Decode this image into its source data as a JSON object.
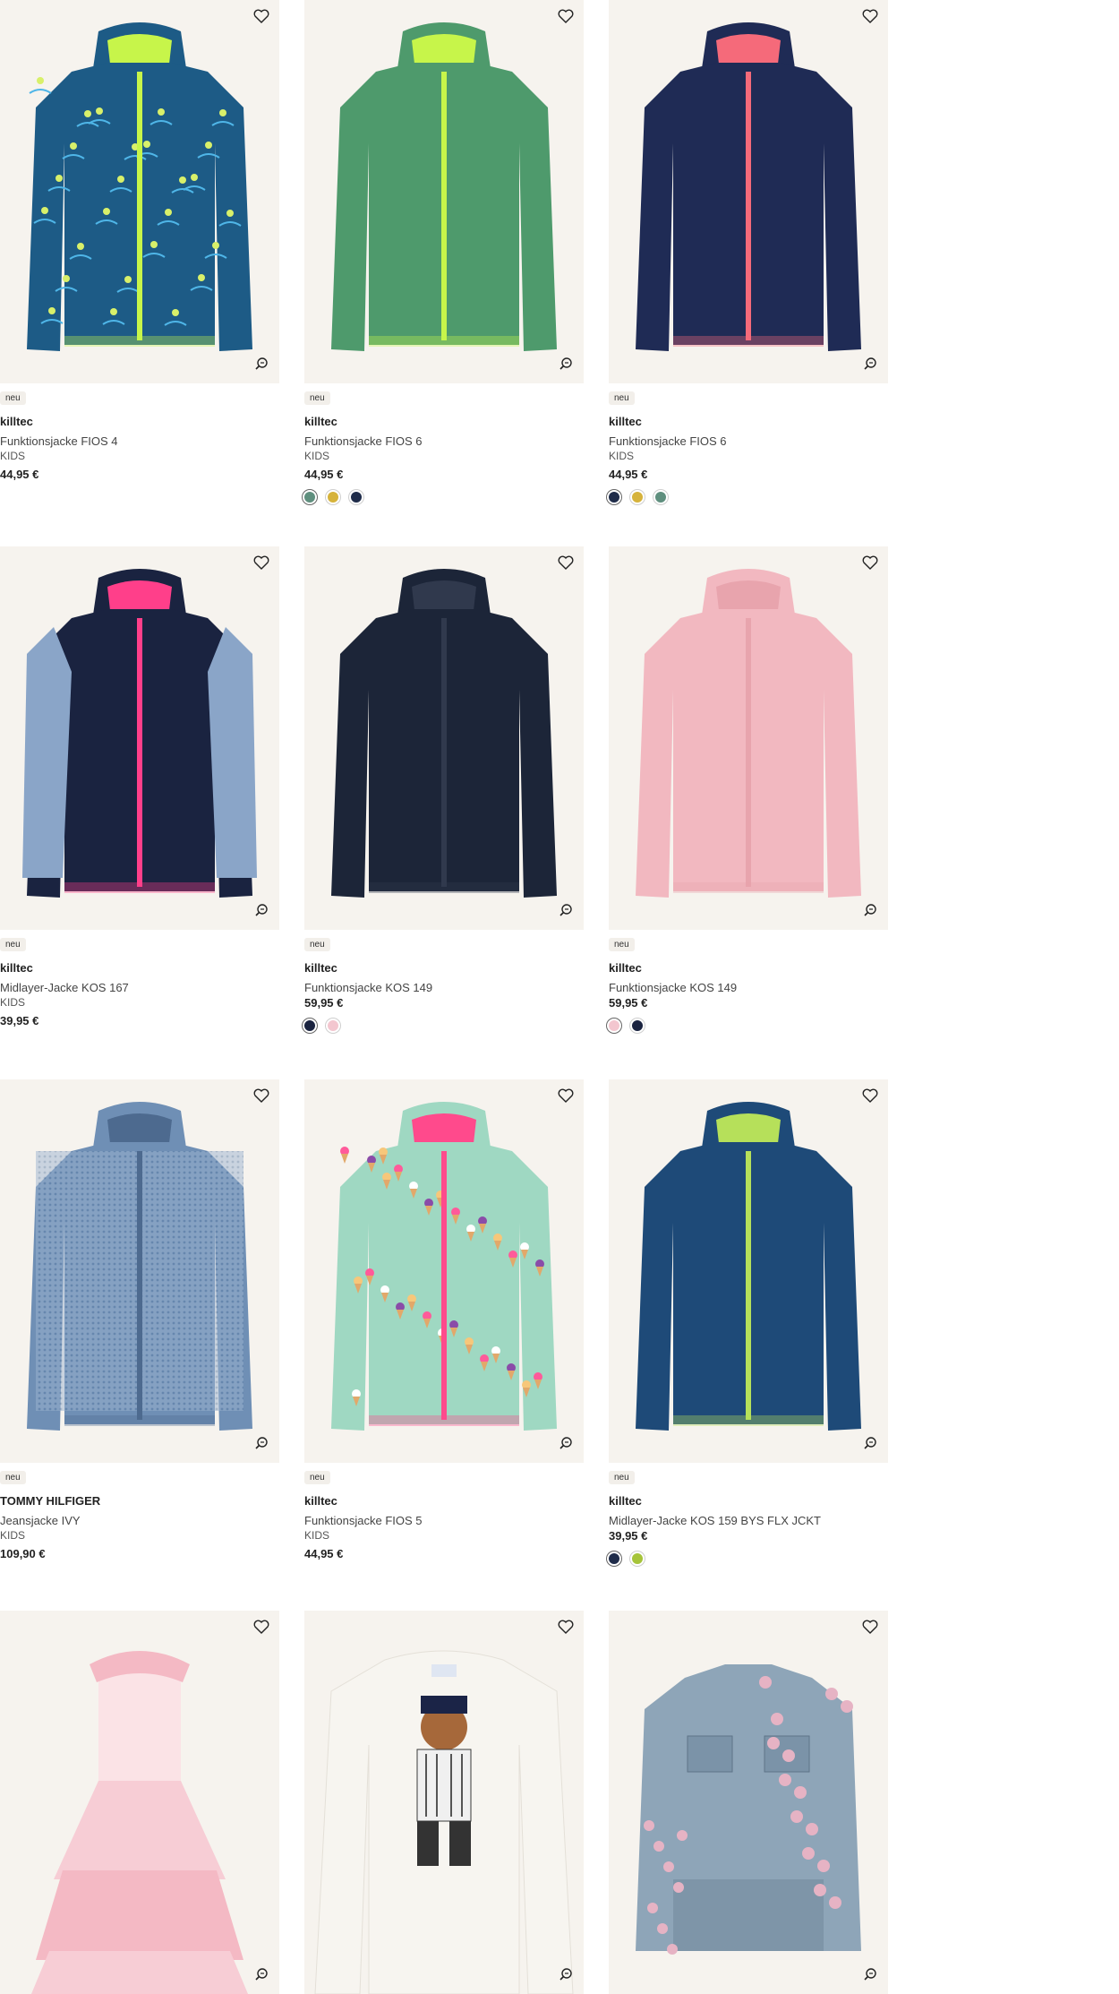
{
  "products": [
    {
      "badge": "neu",
      "brand": "killtec",
      "name": "Funktionsjacke FIOS 4",
      "sub": "KIDS",
      "price": "44,95 €",
      "colors": [],
      "art": {
        "body": "#1d5b86",
        "accent": "#c7f54a",
        "pattern": "palm"
      }
    },
    {
      "badge": "neu",
      "brand": "killtec",
      "name": "Funktionsjacke FIOS 6",
      "sub": "KIDS",
      "price": "44,95 €",
      "colors": [
        "#5f8f7e",
        "#d6b33b",
        "#1f2c4a"
      ],
      "art": {
        "body": "#4e9a6c",
        "accent": "#c7f54a",
        "pattern": "plain"
      }
    },
    {
      "badge": "neu",
      "brand": "killtec",
      "name": "Funktionsjacke FIOS 6",
      "sub": "KIDS",
      "price": "44,95 €",
      "colors": [
        "#1f2c4a",
        "#d6b33b",
        "#5f8f7e"
      ],
      "art": {
        "body": "#1f2b55",
        "accent": "#f56a7a",
        "pattern": "plain"
      }
    },
    {
      "badge": "neu",
      "brand": "killtec",
      "name": "Midlayer-Jacke KOS 167",
      "sub": "KIDS",
      "price": "39,95 €",
      "colors": [],
      "art": {
        "body": "#1a2340",
        "accent": "#ff3f8a",
        "pattern": "sleeves",
        "sleeve": "#8aa5c8"
      }
    },
    {
      "badge": "neu",
      "brand": "killtec",
      "name": "Funktionsjacke KOS 149",
      "sub": "",
      "price": "59,95 €",
      "colors": [
        "#1a2340",
        "#f3c6cf"
      ],
      "art": {
        "body": "#1c2538",
        "accent": "#30394d",
        "pattern": "plain"
      }
    },
    {
      "badge": "neu",
      "brand": "killtec",
      "name": "Funktionsjacke KOS 149",
      "sub": "",
      "price": "59,95 €",
      "colors": [
        "#f3c6cf",
        "#1a2340"
      ],
      "art": {
        "body": "#f2b8c0",
        "accent": "#e8a4ad",
        "pattern": "plain"
      }
    },
    {
      "badge": "neu",
      "brand": "TOMMY HILFIGER",
      "name": "Jeansjacke IVY",
      "sub": "KIDS",
      "price": "109,90 €",
      "colors": [],
      "art": {
        "body": "#6f8fb5",
        "accent": "#4d6a8f",
        "pattern": "denim"
      }
    },
    {
      "badge": "neu",
      "brand": "killtec",
      "name": "Funktionsjacke FIOS 5",
      "sub": "KIDS",
      "price": "44,95 €",
      "colors": [],
      "art": {
        "body": "#9fd8c2",
        "accent": "#ff4a8c",
        "pattern": "icecream"
      }
    },
    {
      "badge": "neu",
      "brand": "killtec",
      "name": "Midlayer-Jacke KOS 159 BYS FLX JCKT",
      "sub": "",
      "price": "39,95 €",
      "colors": [
        "#1f2c4a",
        "#a6c43a"
      ],
      "art": {
        "body": "#1e4a78",
        "accent": "#b6e05a",
        "pattern": "plain"
      }
    },
    {
      "badge": "",
      "brand": "",
      "name": "",
      "sub": "",
      "price": "",
      "colors": [],
      "art": {
        "body": "#f7cdd5",
        "accent": "#f4b9c4",
        "pattern": "dress"
      }
    },
    {
      "badge": "",
      "brand": "",
      "name": "",
      "sub": "",
      "price": "",
      "colors": [],
      "art": {
        "body": "#f7f5f0",
        "accent": "#3a3a3a",
        "pattern": "sweater"
      }
    },
    {
      "badge": "",
      "brand": "",
      "name": "",
      "sub": "",
      "price": "",
      "colors": [],
      "art": {
        "body": "#8ea5b8",
        "accent": "#e6b3c4",
        "pattern": "denimflower"
      }
    }
  ]
}
